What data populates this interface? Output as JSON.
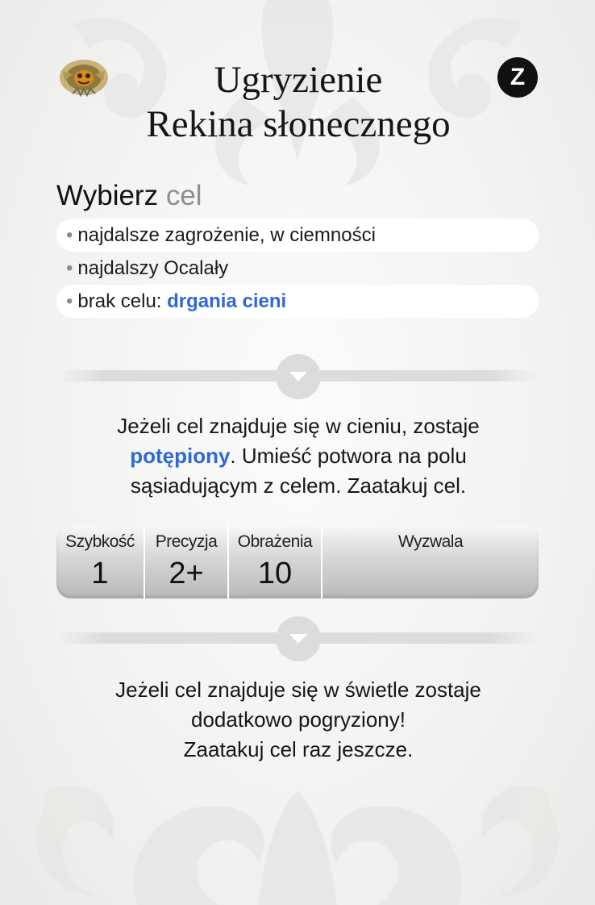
{
  "card": {
    "title_line1": "Ugryzienie",
    "title_line2": "Rekina słonecznego",
    "badge": "Z",
    "emblem_icon": "monster-emblem-icon"
  },
  "target": {
    "heading_word": "Wybierz",
    "heading_muted": "cel",
    "rows": [
      {
        "text": "najdalsze zagrożenie, w ciemności",
        "keyword": ""
      },
      {
        "text": "najdalszy Ocalały",
        "keyword": ""
      },
      {
        "text": "brak celu: ",
        "keyword": "drgania cieni"
      }
    ]
  },
  "effect1": {
    "part1": "Jeżeli cel znajduje się w cieniu, zostaje",
    "keyword": "potępiony",
    "part2": ". Umieść potwora na polu",
    "part3": "sąsiadującym z celem. Zaatakuj cel."
  },
  "stats": [
    {
      "label": "Szybkość",
      "value": "1"
    },
    {
      "label": "Precyzja",
      "value": "2+"
    },
    {
      "label": "Obrażenia",
      "value": "10"
    },
    {
      "label": "Wyzwala",
      "value": ""
    }
  ],
  "effect2": {
    "line1": "Jeżeli cel znajduje się w świetle zostaje",
    "line2": "dodatkowo pogryziony!",
    "line3": "Zaatakuj cel raz jeszcze."
  },
  "colors": {
    "keyword": "#2e68d8",
    "badge_bg": "#111111",
    "muted": "#8f8f8f"
  }
}
